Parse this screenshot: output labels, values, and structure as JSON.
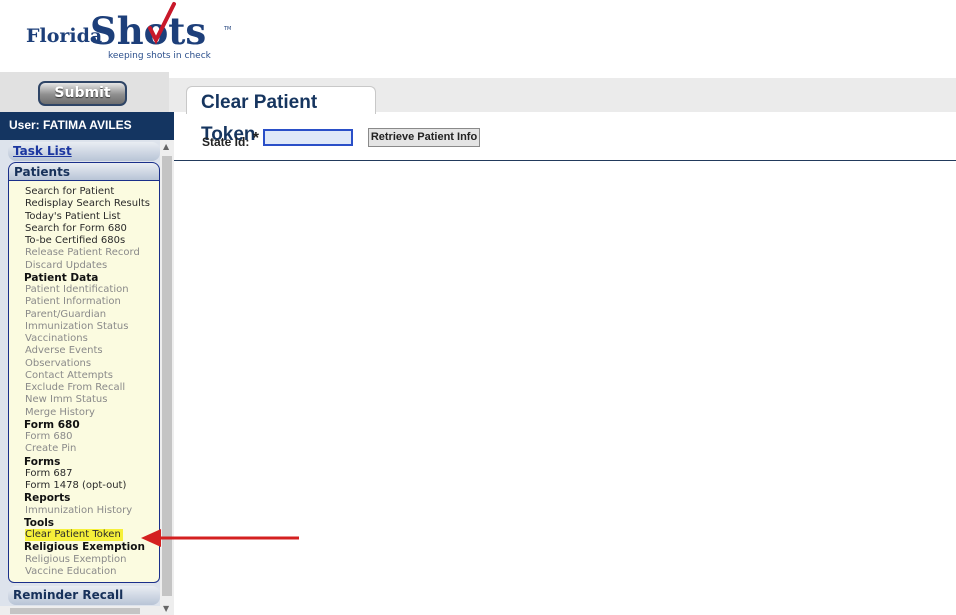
{
  "logo": {
    "word1": "Florida",
    "word2": "Shots",
    "tagline": "keeping shots in check",
    "tm": "TM"
  },
  "toolbar": {
    "submit_label": "Submit"
  },
  "page": {
    "tab_title": "Clear Patient Token"
  },
  "form": {
    "state_id_label": "State Id:",
    "required_mark": "*",
    "state_id_value": "",
    "retrieve_label": "Retrieve Patient Info"
  },
  "sidebar": {
    "user": "User: FATIMA AVILES",
    "task_list": "Task List",
    "patients": "Patients",
    "reminder_recall": "Reminder Recall",
    "items": [
      {
        "label": "Search for Patient",
        "kind": "item",
        "enabled": true
      },
      {
        "label": "Redisplay Search Results",
        "kind": "item",
        "enabled": true
      },
      {
        "label": "Today's Patient List",
        "kind": "item",
        "enabled": true
      },
      {
        "label": "Search for Form 680",
        "kind": "item",
        "enabled": true
      },
      {
        "label": "To-be Certified 680s",
        "kind": "item",
        "enabled": true
      },
      {
        "label": "Release Patient Record",
        "kind": "item",
        "enabled": false
      },
      {
        "label": "Discard Updates",
        "kind": "item",
        "enabled": false
      },
      {
        "label": "Patient Data",
        "kind": "section"
      },
      {
        "label": "Patient Identification",
        "kind": "item",
        "enabled": false
      },
      {
        "label": "Patient Information",
        "kind": "item",
        "enabled": false
      },
      {
        "label": "Parent/Guardian",
        "kind": "item",
        "enabled": false
      },
      {
        "label": "Immunization Status",
        "kind": "item",
        "enabled": false
      },
      {
        "label": "Vaccinations",
        "kind": "item",
        "enabled": false
      },
      {
        "label": "Adverse Events",
        "kind": "item",
        "enabled": false
      },
      {
        "label": "Observations",
        "kind": "item",
        "enabled": false
      },
      {
        "label": "Contact Attempts",
        "kind": "item",
        "enabled": false
      },
      {
        "label": "Exclude From Recall",
        "kind": "item",
        "enabled": false
      },
      {
        "label": "New Imm Status",
        "kind": "item",
        "enabled": false
      },
      {
        "label": "Merge History",
        "kind": "item",
        "enabled": false
      },
      {
        "label": "Form 680",
        "kind": "section"
      },
      {
        "label": "Form 680",
        "kind": "item",
        "enabled": false
      },
      {
        "label": "Create Pin",
        "kind": "item",
        "enabled": false
      },
      {
        "label": "Forms",
        "kind": "section"
      },
      {
        "label": "Form 687",
        "kind": "item",
        "enabled": true
      },
      {
        "label": "Form 1478 (opt-out)",
        "kind": "item",
        "enabled": true
      },
      {
        "label": "Reports",
        "kind": "section"
      },
      {
        "label": "Immunization History",
        "kind": "item",
        "enabled": false
      },
      {
        "label": "Tools",
        "kind": "section"
      },
      {
        "label": "Clear Patient Token",
        "kind": "item",
        "enabled": true,
        "highlight": true
      },
      {
        "label": "Religious Exemption",
        "kind": "section"
      },
      {
        "label": "Religious Exemption",
        "kind": "item",
        "enabled": false
      },
      {
        "label": "Vaccine Education",
        "kind": "item",
        "enabled": false
      }
    ]
  },
  "colors": {
    "brand_navy": "#143561",
    "highlight": "#f6f03a",
    "arrow": "#d42020",
    "checkmark": "#c8182a"
  }
}
